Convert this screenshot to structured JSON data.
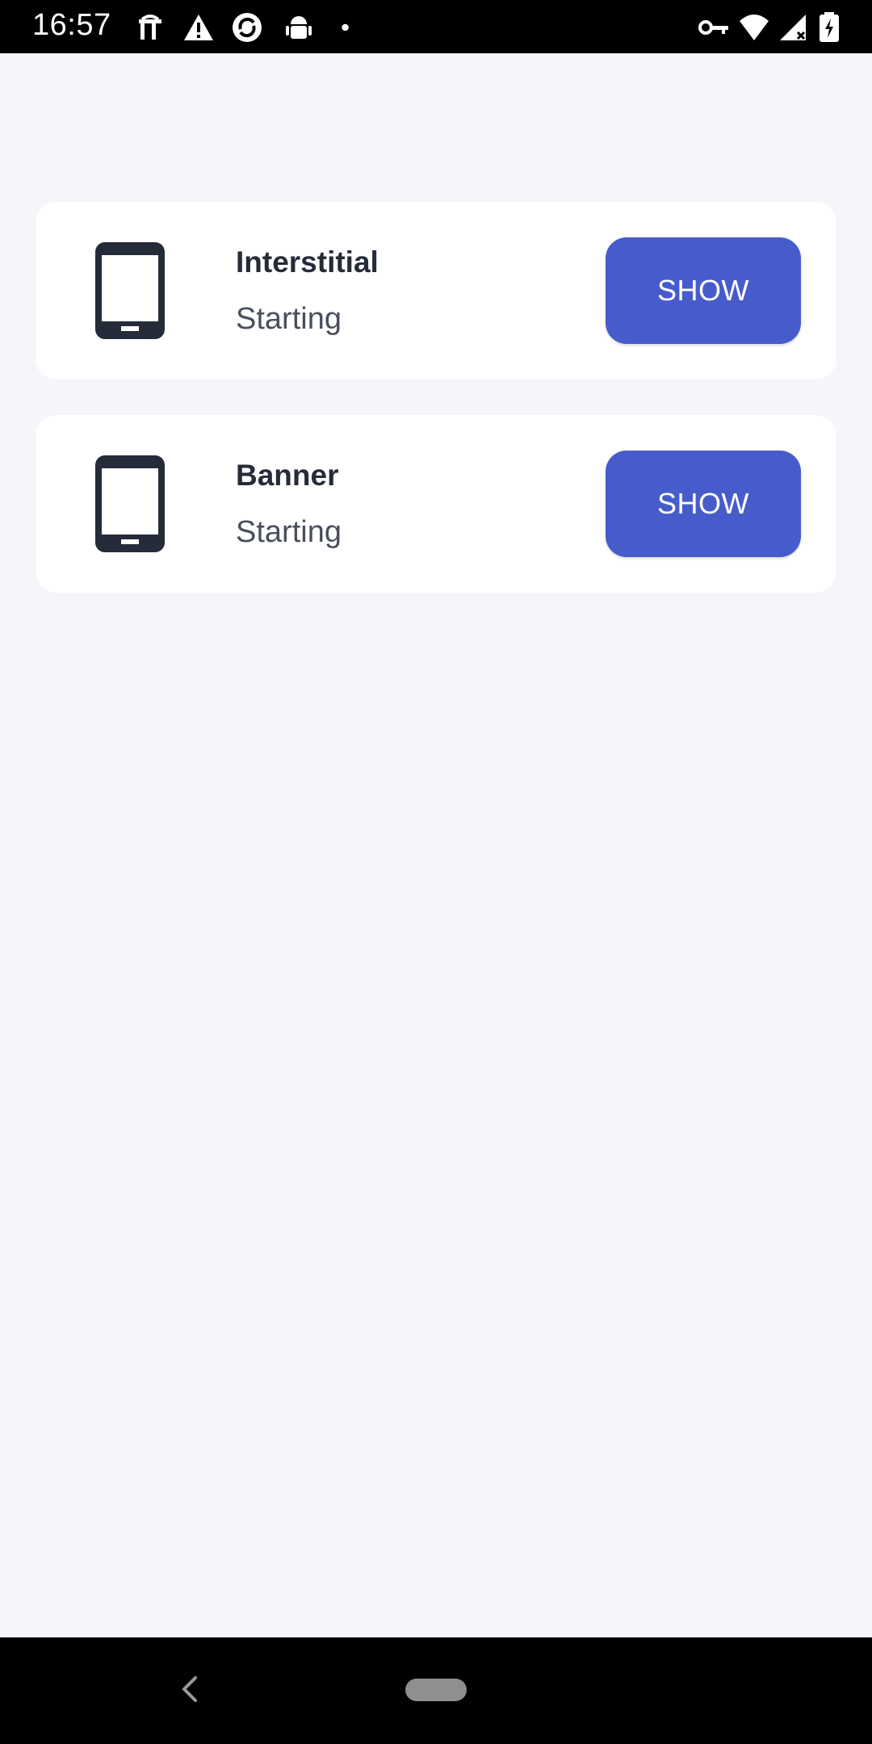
{
  "status_bar": {
    "time": "16:57",
    "icons_left": [
      "tools-icon",
      "warning-icon",
      "sync-icon",
      "android-icon",
      "dot-icon"
    ],
    "icons_right": [
      "vpn-key-icon",
      "wifi-icon",
      "signal-icon",
      "battery-charging-icon"
    ]
  },
  "cards": [
    {
      "icon": "smartphone-icon",
      "title": "Interstitial",
      "status": "Starting",
      "button_label": "SHOW"
    },
    {
      "icon": "smartphone-icon",
      "title": "Banner",
      "status": "Starting",
      "button_label": "SHOW"
    }
  ],
  "colors": {
    "background": "#f4f6fa",
    "card": "#ffffff",
    "accent": "#475ccb",
    "title_text": "#262b3a",
    "status_text": "#4a4f5d"
  },
  "nav_bar": {
    "icons": [
      "back-icon",
      "home-pill-icon"
    ]
  }
}
